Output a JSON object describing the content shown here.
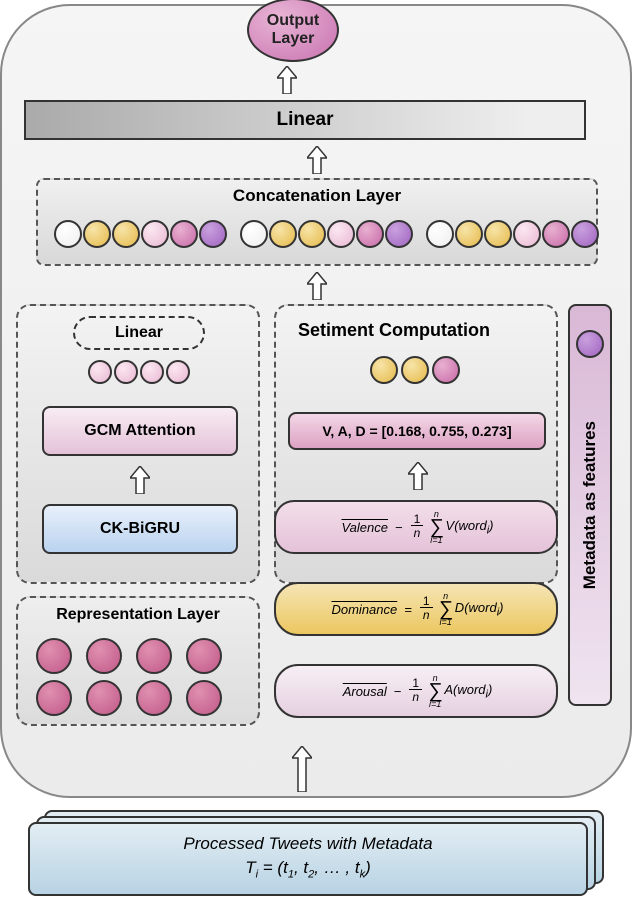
{
  "output_label": "Output\nLayer",
  "linear_main": "Linear",
  "concat_title": "Concatenation Layer",
  "linear_small": "Linear",
  "gcm_label": "GCM Attention",
  "ckbigru_label": "CK-BiGRU",
  "rep_title": "Representation Layer",
  "sentiment_title": "Setiment Computation",
  "vad_label": "V, A, D = [0.168, 0.755, 0.273]",
  "formulas": {
    "valence": {
      "name": "Valence",
      "fn": "V",
      "op": "−"
    },
    "dominance": {
      "name": "Dominance",
      "fn": "D",
      "op": "="
    },
    "arousal": {
      "name": "Arousal",
      "fn": "A",
      "op": "−"
    }
  },
  "metadata_label": "Metadata as features",
  "input_line1": "Processed Tweets with Metadata",
  "input_line2_prefix": "T",
  "input_line2_sub": "i",
  "input_line2_eq": " = (t",
  "input_tokens": [
    "1",
    "2",
    "k"
  ]
}
